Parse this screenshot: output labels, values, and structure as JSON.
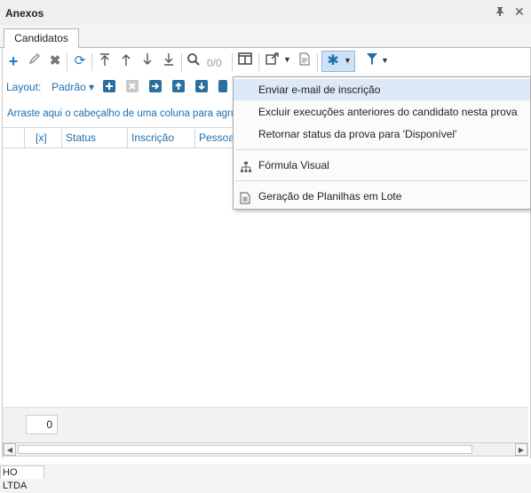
{
  "panel": {
    "title": "Anexos",
    "pin_icon": "pin-icon",
    "close_icon": "close-icon"
  },
  "tabs": [
    {
      "label": "Candidatos"
    }
  ],
  "toolbar": {
    "counter": "0/0",
    "icons": [
      "add-icon",
      "edit-icon",
      "delete-icon",
      "refresh-icon",
      "move-top-icon",
      "move-up-icon",
      "move-down-icon",
      "move-bottom-icon",
      "search-icon",
      "columns-icon",
      "export-icon",
      "report-icon",
      "gear-icon",
      "filter-icon"
    ]
  },
  "layout_bar": {
    "label": "Layout:",
    "selected": "Padrão"
  },
  "group_hint": "Arraste aqui o cabeçalho de uma coluna para agrupa",
  "grid": {
    "columns": [
      {
        "label": ""
      },
      {
        "label": "[x]"
      },
      {
        "label": "Status"
      },
      {
        "label": "Inscrição"
      },
      {
        "label": "Pessoa"
      }
    ]
  },
  "footer": {
    "count": "0"
  },
  "bottom_tab": "HO LTDA",
  "context_menu": {
    "items": [
      {
        "label": "Enviar e-mail de inscrição",
        "icon": "",
        "highlighted": true
      },
      {
        "label": "Excluir execuções anteriores do candidato nesta prova",
        "icon": ""
      },
      {
        "label": "Retornar status da prova para 'Disponível'",
        "icon": ""
      },
      {
        "label": "Fórmula Visual",
        "icon": "hierarchy-icon"
      },
      {
        "label": "Geração de Planilhas em Lote",
        "icon": "spreadsheet-icon"
      }
    ]
  },
  "colors": {
    "accent": "#1f6fae",
    "highlight": "#dde9f7",
    "add_green": "#1f7bc7"
  }
}
